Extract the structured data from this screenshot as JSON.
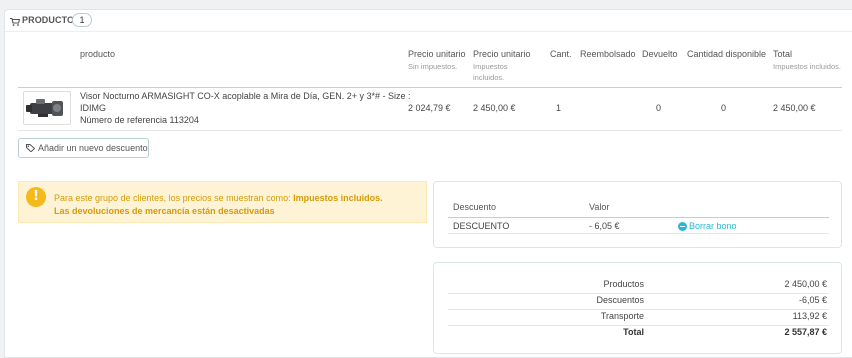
{
  "panel": {
    "title": "PRODUCTOS",
    "count": "1"
  },
  "table": {
    "headers": {
      "product": "producto",
      "unit_price_excl": "Precio unitario",
      "unit_price_excl_sub": "Sin impuestos.",
      "unit_price_incl": "Precio unitario",
      "unit_price_incl_sub": "Impuestos incluidos.",
      "qty": "Cant.",
      "refunded": "Reembolsado",
      "returned": "Devuelto",
      "available": "Cantidad disponible",
      "total": "Total",
      "total_sub": "Impuestos incluidos."
    },
    "rows": [
      {
        "name_line1": "Visor Nocturno ARMASIGHT CO-X acoplable a Mira de Día, GEN. 2+ y 3*# - Size :",
        "name_line2": "IDIMG",
        "reference": "Número de referencia 113204",
        "unit_price_excl": "2 024,79 €",
        "unit_price_incl": "2 450,00 €",
        "qty": "1",
        "refunded": "",
        "returned": "0",
        "available": "0",
        "total": "2 450,00 €"
      }
    ]
  },
  "add_discount_button": "Añadir un nuevo descuento",
  "alert": {
    "text_prefix": "Para este grupo de clientes, los precios se muestran como: ",
    "text_bold": "Impuestos incluidos.",
    "line2": "Las devoluciones de mercancía están desactivadas"
  },
  "discounts": {
    "headers": {
      "name": "Descuento",
      "value": "Valor"
    },
    "rows": [
      {
        "name": "DESCUENTO",
        "value": "- 6,05 €",
        "action": "Borrar bono"
      }
    ]
  },
  "totals": {
    "products_label": "Productos",
    "products_value": "2 450,00 €",
    "discounts_label": "Descuentos",
    "discounts_value": "-6,05 €",
    "shipping_label": "Transporte",
    "shipping_value": "113,92 €",
    "total_label": "Total",
    "total_value": "2 557,87 €"
  }
}
